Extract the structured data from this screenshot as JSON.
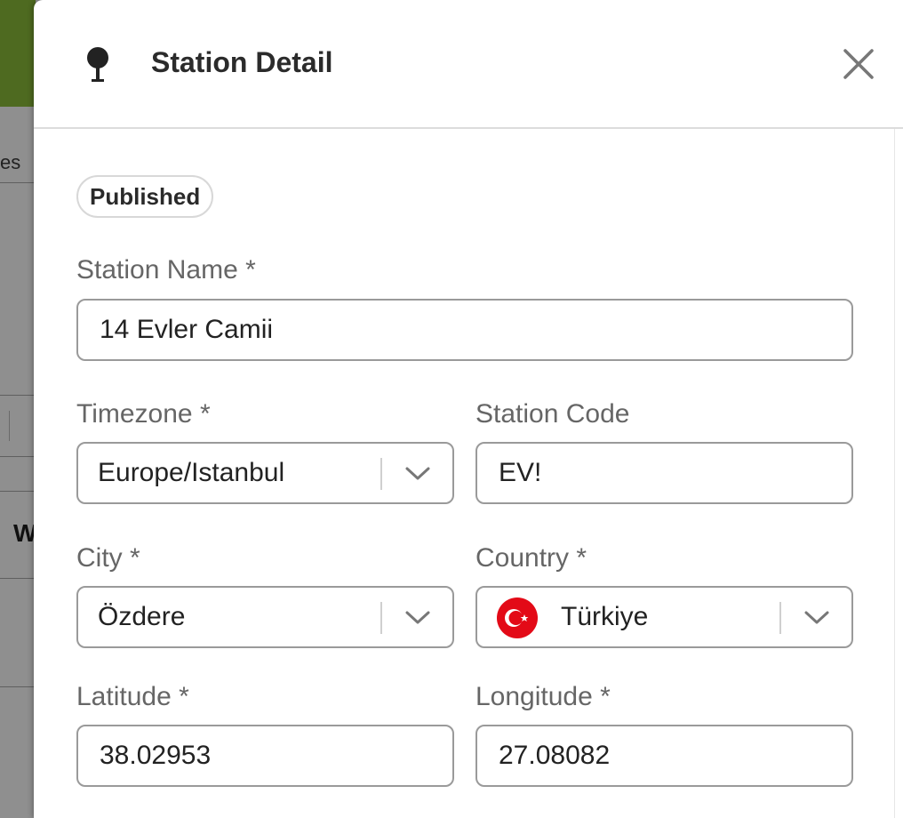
{
  "background": {
    "tab_fragment": "es",
    "bold_fragment": "W"
  },
  "drawer": {
    "title": "Station Detail",
    "header_icon": "map-pin-icon",
    "close_icon": "close-icon",
    "status_badge": "Published",
    "fields": {
      "station_name": {
        "label": "Station Name *",
        "value": "14 Evler Camii"
      },
      "timezone": {
        "label": "Timezone *",
        "value": "Europe/Istanbul"
      },
      "station_code": {
        "label": "Station Code",
        "value": "EV!"
      },
      "city": {
        "label": "City *",
        "value": "Özdere"
      },
      "country": {
        "label": "Country *",
        "value": "Türkiye",
        "flag_icon": "turkey-flag-icon"
      },
      "latitude": {
        "label": "Latitude *",
        "value": "38.02953"
      },
      "longitude": {
        "label": "Longitude *",
        "value": "27.08082"
      }
    }
  },
  "colors": {
    "brand_green": "#4e6a20",
    "overlay_gray": "#8e8e8e",
    "flag_red": "#e30a17"
  }
}
